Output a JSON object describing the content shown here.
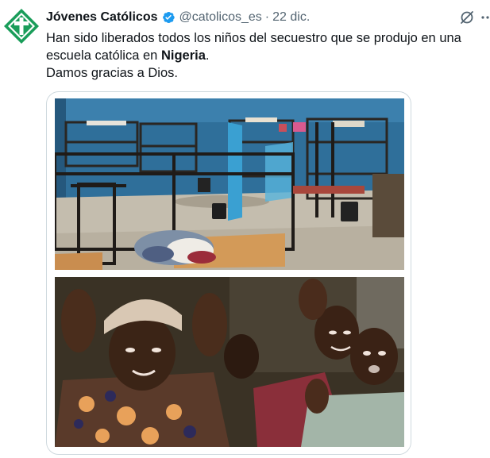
{
  "tweet": {
    "author": {
      "display_name": "Jóvenes Católicos",
      "handle": "@catolicos_es",
      "date": "22 dic.",
      "separator": "·",
      "verified": true,
      "avatar_icon": "cross-logo-icon"
    },
    "text": {
      "line1": "Han sido liberados todos los niños del secuestro que se produjo en una",
      "line2_prefix": "escuela católica en ",
      "line2_bold": "Nigeria",
      "line2_suffix": ".",
      "line3": "Damos gracias a Dios."
    },
    "icons": {
      "grok": "grok-icon",
      "more": "more-options-icon",
      "verified": "verified-badge-icon"
    },
    "media": {
      "count": 2,
      "photos": [
        {
          "name": "dormitory-photo"
        },
        {
          "name": "freed-children-photo"
        }
      ]
    },
    "colors": {
      "brand_green": "#1a9d5a",
      "verified_blue": "#1d9bf0",
      "text_primary": "#0f1419",
      "text_secondary": "#536471",
      "border": "#cfd9de"
    }
  }
}
